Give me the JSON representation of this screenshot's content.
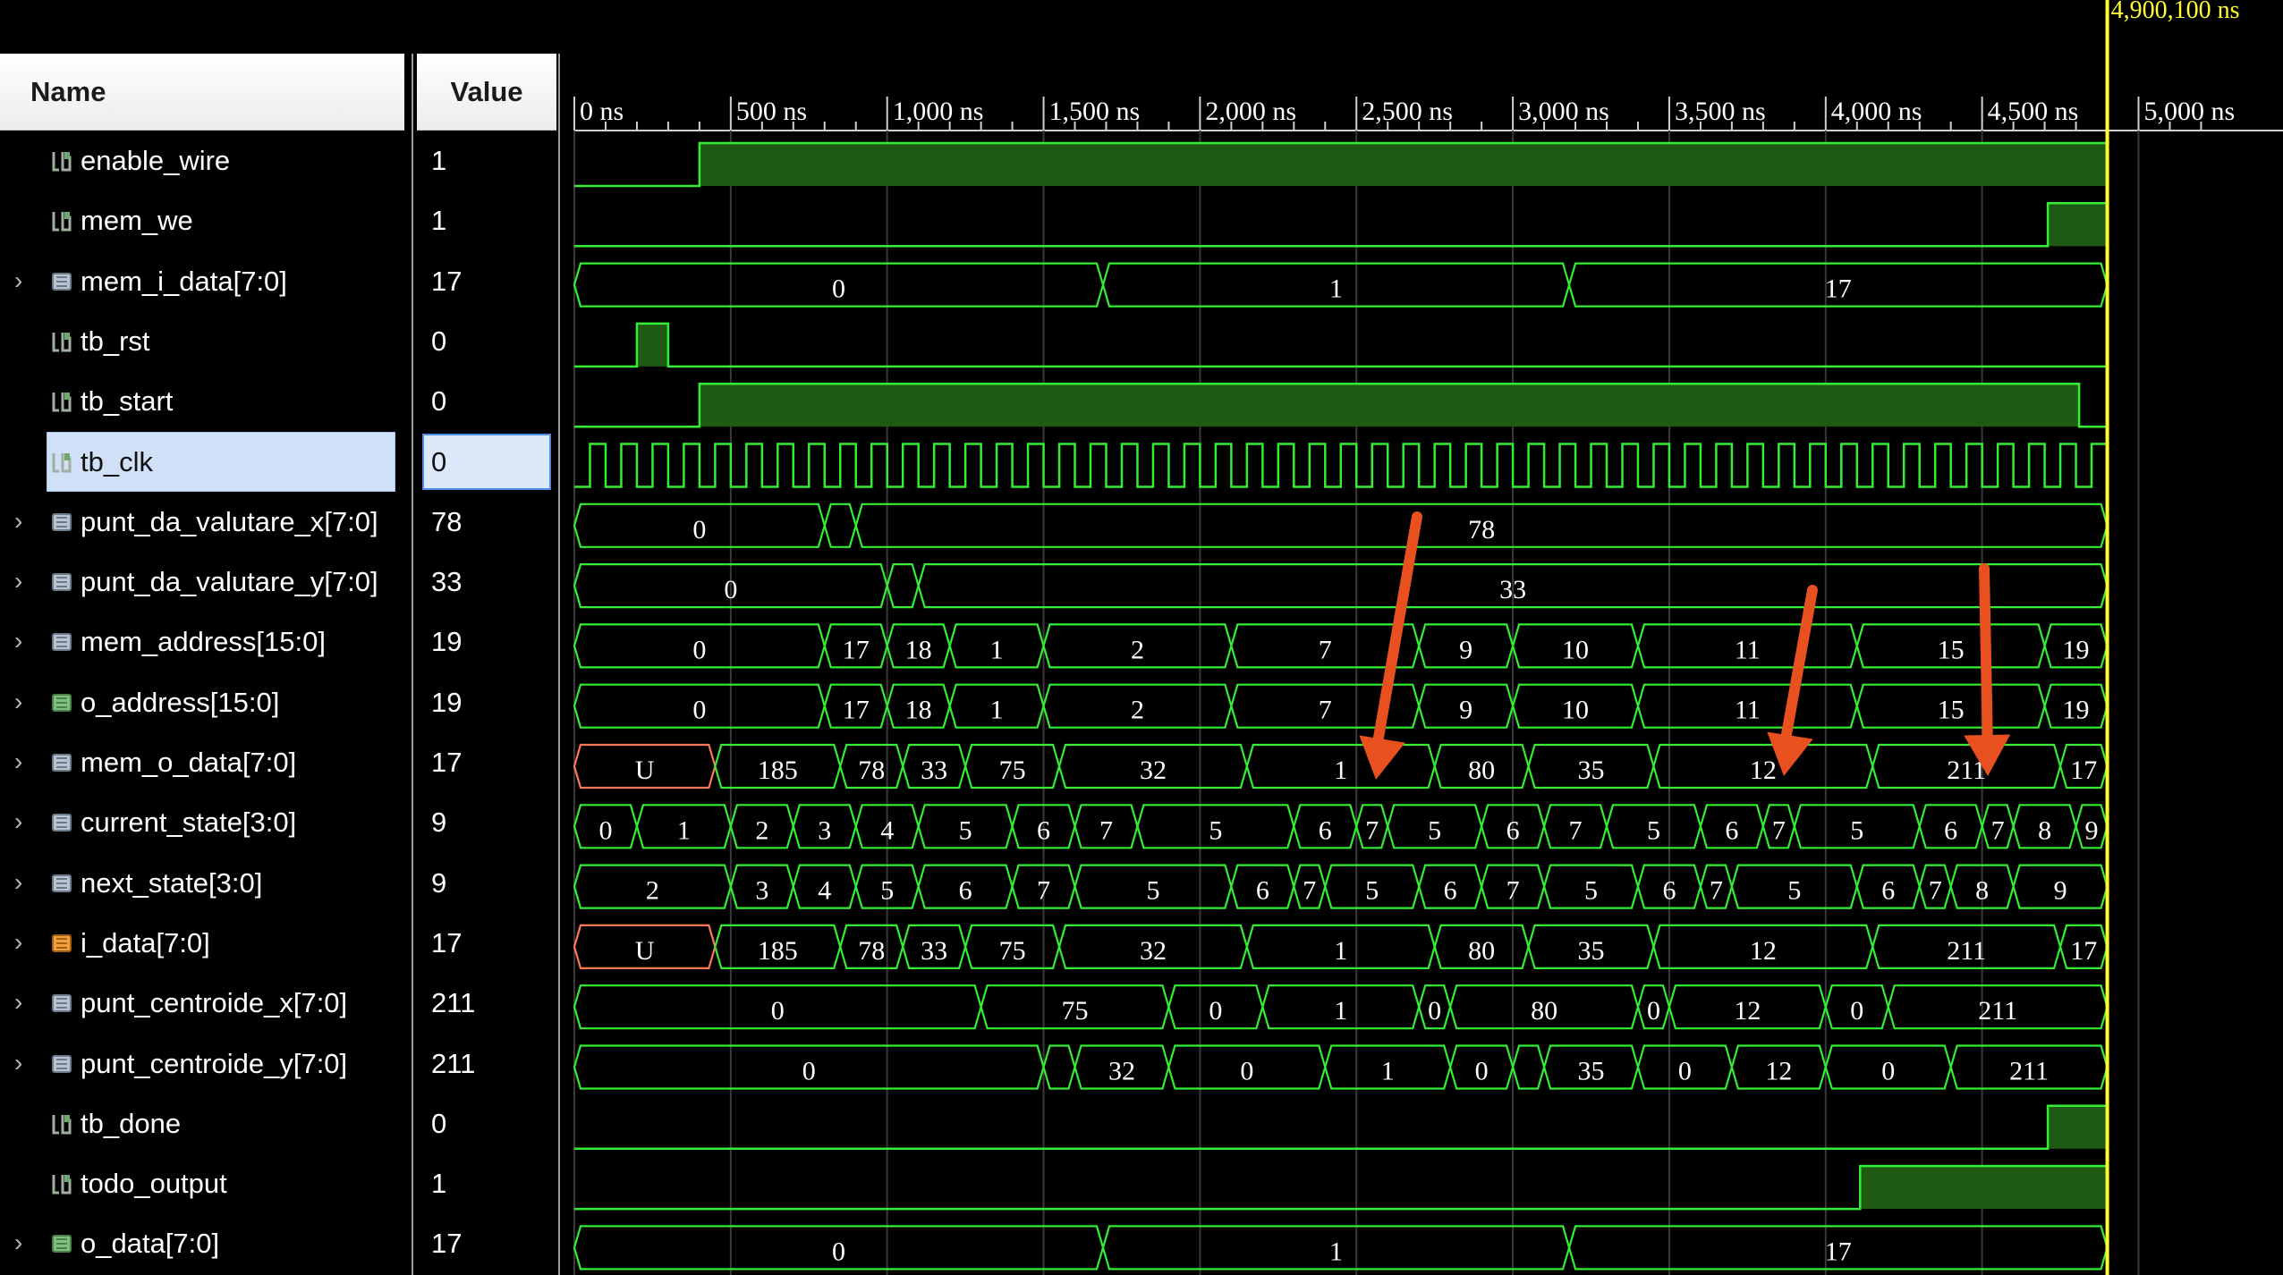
{
  "columns": {
    "name": "Name",
    "value": "Value"
  },
  "cursor": {
    "label": "4,900,100 ns",
    "color": "#ffff33"
  },
  "colors": {
    "wave": "#33ee33",
    "bus_fill": "#000000",
    "high_fill": "#1e5a14",
    "undefined": "#ff7755",
    "arrow": "#e85020",
    "selected_row": "#cfe0f7"
  },
  "timeline": {
    "ticks": [
      {
        "t": 0,
        "label": "0 ns"
      },
      {
        "t": 500,
        "label": "500 ns"
      },
      {
        "t": 1000,
        "label": "1,000 ns"
      },
      {
        "t": 1500,
        "label": "1,500 ns"
      },
      {
        "t": 2000,
        "label": "2,000 ns"
      },
      {
        "t": 2500,
        "label": "2,500 ns"
      },
      {
        "t": 3000,
        "label": "3,000 ns"
      },
      {
        "t": 3500,
        "label": "3,500 ns"
      },
      {
        "t": 4000,
        "label": "4,000 ns"
      },
      {
        "t": 4500,
        "label": "4,500 ns"
      },
      {
        "t": 5000,
        "label": "5,000 ns"
      }
    ],
    "cursor_t": 4900.1,
    "visible_range_ns": [
      0,
      5200
    ]
  },
  "signals": [
    {
      "name": "enable_wire",
      "value": "1",
      "kind": "bit",
      "expandable": false,
      "icon": "bit-icon",
      "edges": [
        [
          0,
          0
        ],
        [
          400,
          1
        ]
      ]
    },
    {
      "name": "mem_we",
      "value": "1",
      "kind": "bit",
      "expandable": false,
      "icon": "bit-icon",
      "edges": [
        [
          0,
          0
        ],
        [
          4710,
          1
        ]
      ]
    },
    {
      "name": "mem_i_data[7:0]",
      "value": "17",
      "kind": "bus",
      "expandable": true,
      "icon": "bus-icon",
      "segments": [
        [
          0,
          1690,
          "0"
        ],
        [
          1690,
          3180,
          "1"
        ],
        [
          3180,
          4900,
          "17"
        ]
      ]
    },
    {
      "name": "tb_rst",
      "value": "0",
      "kind": "bit",
      "expandable": false,
      "icon": "bit-icon",
      "edges": [
        [
          0,
          0
        ],
        [
          200,
          1
        ],
        [
          300,
          0
        ]
      ]
    },
    {
      "name": "tb_start",
      "value": "0",
      "kind": "bit",
      "expandable": false,
      "icon": "bit-icon",
      "edges": [
        [
          0,
          0
        ],
        [
          400,
          1
        ],
        [
          4810,
          0
        ]
      ]
    },
    {
      "name": "tb_clk",
      "value": "0",
      "kind": "clock",
      "expandable": false,
      "icon": "bit-icon",
      "selected": true,
      "period_ns": 100
    },
    {
      "name": "punt_da_valutare_x[7:0]",
      "value": "78",
      "kind": "bus",
      "expandable": true,
      "icon": "bus-icon",
      "segments": [
        [
          0,
          800,
          "0"
        ],
        [
          800,
          900,
          ""
        ],
        [
          900,
          4900,
          "78"
        ]
      ]
    },
    {
      "name": "punt_da_valutare_y[7:0]",
      "value": "33",
      "kind": "bus",
      "expandable": true,
      "icon": "bus-icon",
      "segments": [
        [
          0,
          1000,
          "0"
        ],
        [
          1000,
          1100,
          ""
        ],
        [
          1100,
          4900,
          "33"
        ]
      ]
    },
    {
      "name": "mem_address[15:0]",
      "value": "19",
      "kind": "bus",
      "expandable": true,
      "icon": "bus-icon",
      "segments": [
        [
          0,
          800,
          "0"
        ],
        [
          800,
          1000,
          "17"
        ],
        [
          1000,
          1200,
          "18"
        ],
        [
          1200,
          1500,
          "1"
        ],
        [
          1500,
          2100,
          "2"
        ],
        [
          2100,
          2700,
          "7"
        ],
        [
          2700,
          3000,
          "9"
        ],
        [
          3000,
          3400,
          "10"
        ],
        [
          3400,
          4100,
          "11"
        ],
        [
          4100,
          4700,
          "15"
        ],
        [
          4700,
          4900,
          "19"
        ]
      ]
    },
    {
      "name": "o_address[15:0]",
      "value": "19",
      "kind": "bus",
      "expandable": true,
      "icon": "bus-icon-green",
      "segments": [
        [
          0,
          800,
          "0"
        ],
        [
          800,
          1000,
          "17"
        ],
        [
          1000,
          1200,
          "18"
        ],
        [
          1200,
          1500,
          "1"
        ],
        [
          1500,
          2100,
          "2"
        ],
        [
          2100,
          2700,
          "7"
        ],
        [
          2700,
          3000,
          "9"
        ],
        [
          3000,
          3400,
          "10"
        ],
        [
          3400,
          4100,
          "11"
        ],
        [
          4100,
          4700,
          "15"
        ],
        [
          4700,
          4900,
          "19"
        ]
      ]
    },
    {
      "name": "mem_o_data[7:0]",
      "value": "17",
      "kind": "bus",
      "expandable": true,
      "icon": "bus-icon",
      "segments": [
        [
          0,
          450,
          "U"
        ],
        [
          450,
          850,
          "185"
        ],
        [
          850,
          1050,
          "78"
        ],
        [
          1050,
          1250,
          "33"
        ],
        [
          1250,
          1550,
          "75"
        ],
        [
          1550,
          2150,
          "32"
        ],
        [
          2150,
          2750,
          "1"
        ],
        [
          2750,
          3050,
          "80"
        ],
        [
          3050,
          3450,
          "35"
        ],
        [
          3450,
          4150,
          "12"
        ],
        [
          4150,
          4750,
          "211"
        ],
        [
          4750,
          4900,
          "17"
        ]
      ]
    },
    {
      "name": "current_state[3:0]",
      "value": "9",
      "kind": "bus",
      "expandable": true,
      "icon": "bus-icon",
      "segments": [
        [
          0,
          200,
          "0"
        ],
        [
          200,
          500,
          "1"
        ],
        [
          500,
          700,
          "2"
        ],
        [
          700,
          900,
          "3"
        ],
        [
          900,
          1100,
          "4"
        ],
        [
          1100,
          1400,
          "5"
        ],
        [
          1400,
          1600,
          "6"
        ],
        [
          1600,
          1800,
          "7"
        ],
        [
          1800,
          2300,
          "5"
        ],
        [
          2300,
          2500,
          "6"
        ],
        [
          2500,
          2600,
          "7"
        ],
        [
          2600,
          2900,
          "5"
        ],
        [
          2900,
          3100,
          "6"
        ],
        [
          3100,
          3300,
          "7"
        ],
        [
          3300,
          3600,
          "5"
        ],
        [
          3600,
          3800,
          "6"
        ],
        [
          3800,
          3900,
          "7"
        ],
        [
          3900,
          4300,
          "5"
        ],
        [
          4300,
          4500,
          "6"
        ],
        [
          4500,
          4600,
          "7"
        ],
        [
          4600,
          4800,
          "8"
        ],
        [
          4800,
          4900,
          "9"
        ]
      ]
    },
    {
      "name": "next_state[3:0]",
      "value": "9",
      "kind": "bus",
      "expandable": true,
      "icon": "bus-icon",
      "segments": [
        [
          0,
          500,
          "2"
        ],
        [
          500,
          700,
          "3"
        ],
        [
          700,
          900,
          "4"
        ],
        [
          900,
          1100,
          "5"
        ],
        [
          1100,
          1400,
          "6"
        ],
        [
          1400,
          1600,
          "7"
        ],
        [
          1600,
          2100,
          "5"
        ],
        [
          2100,
          2300,
          "6"
        ],
        [
          2300,
          2400,
          "7"
        ],
        [
          2400,
          2700,
          "5"
        ],
        [
          2700,
          2900,
          "6"
        ],
        [
          2900,
          3100,
          "7"
        ],
        [
          3100,
          3400,
          "5"
        ],
        [
          3400,
          3600,
          "6"
        ],
        [
          3600,
          3700,
          "7"
        ],
        [
          3700,
          4100,
          "5"
        ],
        [
          4100,
          4300,
          "6"
        ],
        [
          4300,
          4400,
          "7"
        ],
        [
          4400,
          4600,
          "8"
        ],
        [
          4600,
          4900,
          "9"
        ]
      ]
    },
    {
      "name": "i_data[7:0]",
      "value": "17",
      "kind": "bus",
      "expandable": true,
      "icon": "bus-icon-orange",
      "segments": [
        [
          0,
          450,
          "U"
        ],
        [
          450,
          850,
          "185"
        ],
        [
          850,
          1050,
          "78"
        ],
        [
          1050,
          1250,
          "33"
        ],
        [
          1250,
          1550,
          "75"
        ],
        [
          1550,
          2150,
          "32"
        ],
        [
          2150,
          2750,
          "1"
        ],
        [
          2750,
          3050,
          "80"
        ],
        [
          3050,
          3450,
          "35"
        ],
        [
          3450,
          4150,
          "12"
        ],
        [
          4150,
          4750,
          "211"
        ],
        [
          4750,
          4900,
          "17"
        ]
      ]
    },
    {
      "name": "punt_centroide_x[7:0]",
      "value": "211",
      "kind": "bus",
      "expandable": true,
      "icon": "bus-icon",
      "segments": [
        [
          0,
          1300,
          "0"
        ],
        [
          1300,
          1900,
          "75"
        ],
        [
          1900,
          2200,
          "0"
        ],
        [
          2200,
          2700,
          "1"
        ],
        [
          2700,
          2800,
          "0"
        ],
        [
          2800,
          3400,
          "80"
        ],
        [
          3400,
          3500,
          "0"
        ],
        [
          3500,
          4000,
          "12"
        ],
        [
          4000,
          4200,
          "0"
        ],
        [
          4200,
          4900,
          "211"
        ]
      ]
    },
    {
      "name": "punt_centroide_y[7:0]",
      "value": "211",
      "kind": "bus",
      "expandable": true,
      "icon": "bus-icon",
      "segments": [
        [
          0,
          1500,
          "0"
        ],
        [
          1500,
          1600,
          ""
        ],
        [
          1600,
          1900,
          "32"
        ],
        [
          1900,
          2400,
          "0"
        ],
        [
          2400,
          2800,
          "1"
        ],
        [
          2800,
          3000,
          "0"
        ],
        [
          3000,
          3100,
          ""
        ],
        [
          3100,
          3400,
          "35"
        ],
        [
          3400,
          3700,
          "0"
        ],
        [
          3700,
          4000,
          "12"
        ],
        [
          4000,
          4400,
          "0"
        ],
        [
          4400,
          4900,
          "211"
        ]
      ]
    },
    {
      "name": "tb_done",
      "value": "0",
      "kind": "bit",
      "expandable": false,
      "icon": "bit-icon",
      "edges": [
        [
          0,
          0
        ],
        [
          4710,
          1
        ]
      ]
    },
    {
      "name": "todo_output",
      "value": "1",
      "kind": "bit",
      "expandable": false,
      "icon": "bit-icon",
      "edges": [
        [
          0,
          0
        ],
        [
          4110,
          1
        ]
      ]
    },
    {
      "name": "o_data[7:0]",
      "value": "17",
      "kind": "bus",
      "expandable": true,
      "icon": "bus-icon-green",
      "segments": [
        [
          0,
          1690,
          "0"
        ],
        [
          1690,
          3180,
          "1"
        ],
        [
          3180,
          4900,
          "17"
        ]
      ]
    }
  ]
}
